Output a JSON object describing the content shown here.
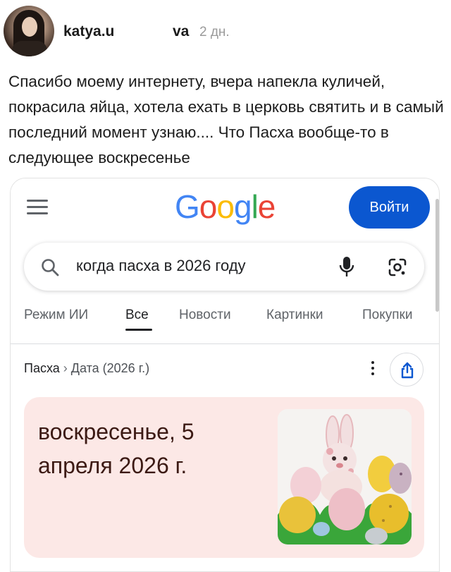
{
  "post": {
    "username_start": "katya.u",
    "username_end": "va",
    "time": "2 дн.",
    "text": "Спасибо моему интернету, вчера напекла куличей, покрасила яйца, хотела ехать в церковь святить и в самый последний момент узнаю.... Что Пасха вообще-то в следующее воскресенье"
  },
  "google": {
    "logo_letters": [
      "G",
      "o",
      "o",
      "g",
      "l",
      "e"
    ],
    "signin_label": "Войти",
    "search": {
      "query": "когда пасха в 2026 году"
    },
    "tabs": [
      {
        "label": "Режим ИИ",
        "active": false
      },
      {
        "label": "Все",
        "active": true
      },
      {
        "label": "Новости",
        "active": false
      },
      {
        "label": "Картинки",
        "active": false
      },
      {
        "label": "Покупки",
        "active": false
      }
    ],
    "breadcrumb": {
      "first": "Пасха",
      "separator": "›",
      "second": "Дата (2026 г.)"
    },
    "answer": {
      "text": "воскресенье, 5 апреля 2026 г."
    }
  },
  "colors": {
    "google_blue": "#4285F4",
    "google_red": "#EA4335",
    "google_yellow": "#FBBC05",
    "google_green": "#34A853",
    "signin_button": "#0b57d0",
    "answer_card_bg": "#fce8e6",
    "answer_text": "#3c1a14"
  },
  "icons": {
    "menu": "hamburger-menu-icon",
    "search": "search-icon",
    "mic": "microphone-icon",
    "lens": "google-lens-icon",
    "more": "kebab-menu-icon",
    "share": "share-icon"
  }
}
